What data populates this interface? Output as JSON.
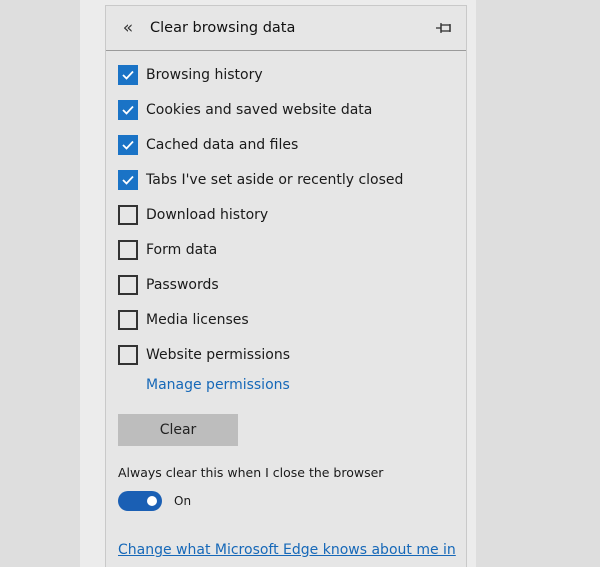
{
  "panel": {
    "title": "Clear browsing data",
    "back_icon": "double-chevron-left-icon",
    "pin_icon": "pin-icon"
  },
  "options": [
    {
      "label": "Browsing history",
      "checked": true
    },
    {
      "label": "Cookies and saved website data",
      "checked": true
    },
    {
      "label": "Cached data and files",
      "checked": true
    },
    {
      "label": "Tabs I've set aside or recently closed",
      "checked": true
    },
    {
      "label": "Download history",
      "checked": false
    },
    {
      "label": "Form data",
      "checked": false
    },
    {
      "label": "Passwords",
      "checked": false
    },
    {
      "label": "Media licenses",
      "checked": false
    },
    {
      "label": "Website permissions",
      "checked": false
    }
  ],
  "manage_permissions_link": "Manage permissions",
  "clear_button": "Clear",
  "always_clear": {
    "label": "Always clear this when I close the browser",
    "state_text": "On",
    "on": true
  },
  "bottom_link": "Change what Microsoft Edge knows about me in",
  "colors": {
    "accent": "#1a73c6",
    "toggle": "#1a5fb4",
    "link": "#1668b8"
  }
}
